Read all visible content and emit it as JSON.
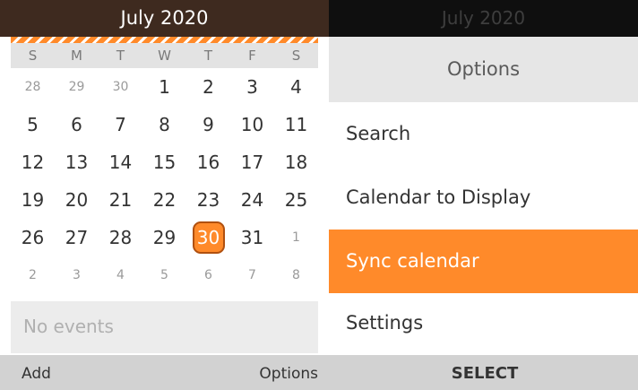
{
  "calendar": {
    "title": "July 2020",
    "weekdays": [
      "S",
      "M",
      "T",
      "W",
      "T",
      "F",
      "S"
    ],
    "weeks": [
      [
        "28",
        "29",
        "30",
        "1",
        "2",
        "3",
        "4"
      ],
      [
        "5",
        "6",
        "7",
        "8",
        "9",
        "10",
        "11"
      ],
      [
        "12",
        "13",
        "14",
        "15",
        "16",
        "17",
        "18"
      ],
      [
        "19",
        "20",
        "21",
        "22",
        "23",
        "24",
        "25"
      ],
      [
        "26",
        "27",
        "28",
        "29",
        "30",
        "31",
        "1"
      ],
      [
        "2",
        "3",
        "4",
        "5",
        "6",
        "7",
        "8"
      ]
    ],
    "dim_cells": [
      "0-0",
      "0-1",
      "0-2",
      "4-6",
      "5-0",
      "5-1",
      "5-2",
      "5-3",
      "5-4",
      "5-5",
      "5-6"
    ],
    "today_cell": "4-4",
    "events_text": "No events"
  },
  "softkeys": {
    "left": "Add",
    "center": "SELECT",
    "right": "Options"
  },
  "options_panel": {
    "top_title": "July 2020",
    "title": "Options",
    "items": [
      {
        "label": "Search"
      },
      {
        "label": "Calendar to Display"
      },
      {
        "label": "Sync calendar"
      },
      {
        "label": "Settings"
      }
    ],
    "selected_index": 2
  },
  "colors": {
    "accent": "#ff8a2a",
    "header_bg": "#3e2a1f"
  }
}
